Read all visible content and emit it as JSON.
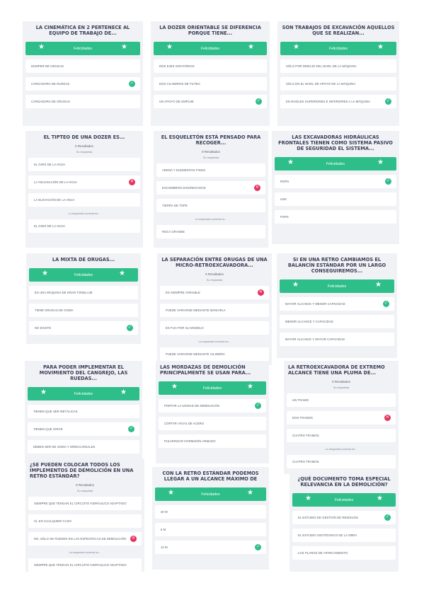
{
  "banner_label": "Felicidades",
  "cards": [
    {
      "q": "LA CINEMÁTICA EN 2 PERTENECE AL EQUIPO DE TRABAJO DE...",
      "banner": true,
      "options": [
        {
          "t": "DUMPER DE ORUGAS",
          "m": ""
        },
        {
          "t": "CARGADORA DE RUEDAS",
          "m": "ok"
        },
        {
          "t": "CARGADORA DE ORUGAS",
          "m": ""
        }
      ]
    },
    {
      "q": "LA DOZER ORIENTABLE SE DIFERENCIA PORQUE TIENE...",
      "banner": true,
      "options": [
        {
          "t": "DOS EJES GIRATORIOS",
          "m": ""
        },
        {
          "t": "DOS CILINDROS DE TILTEO",
          "m": ""
        },
        {
          "t": "UN APOYO DE EMPUJE",
          "m": "ok"
        }
      ]
    },
    {
      "q": "SON TRABAJOS DE EXCAVACIÓN AQUELLOS QUE SE REALIZAN...",
      "banner": true,
      "options": [
        {
          "t": "SÓLO POR DEBAJO DEL NIVEL DE LA MÁQUINA",
          "m": ""
        },
        {
          "t": "SÓLO EN EL NIVEL DE APOYO DE LA MÁQUINA",
          "m": ""
        },
        {
          "t": "EN NIVELES SUPERIORES E INFERIORES A LA MÁQUINA",
          "m": "ok"
        }
      ]
    },
    {
      "q": "EL TIPTEO DE UNA DOZER ES...",
      "res": "0 Resultados",
      "sub": "Su respuesta",
      "options": [
        {
          "t": "EL GIRO DE LA HOJA",
          "m": ""
        },
        {
          "t": "LA INCLINACIÓN DE LA HOJA",
          "m": "bad"
        },
        {
          "t": "LA ELEVACIÓN DE LA HOJA",
          "m": ""
        }
      ],
      "note": "La respuesta correcta es...",
      "extra": [
        {
          "t": "EL GIRO DE LA HOJA",
          "m": ""
        }
      ]
    },
    {
      "q": "EL ESQUELETÓN ESTÁ PENSADO PARA RECOGER...",
      "res": "0 Resultados",
      "sub": "Su respuesta",
      "options": [
        {
          "t": "ARENA Y ELEMENTOS FINOS",
          "m": ""
        },
        {
          "t": "ESCOMBROS DISGREGADOS",
          "m": "bad"
        },
        {
          "t": "TIERRA DE TOPE",
          "m": ""
        }
      ],
      "note": "La respuesta correcta es...",
      "extra": [
        {
          "t": "ROCA GRANDE",
          "m": ""
        }
      ]
    },
    {
      "q": "LAS EXCAVADORAS HIDRÁULICAS FRONTALES TIENEN COMO SISTEMA PASIVO DE SEGURIDAD EL SISTEMA...",
      "banner": true,
      "options": [
        {
          "t": "ROPS",
          "m": "ok"
        },
        {
          "t": "LMS",
          "m": ""
        },
        {
          "t": "FOPS",
          "m": ""
        }
      ]
    },
    {
      "q": "LA MIXTA DE ORUGAS...",
      "banner": true,
      "options": [
        {
          "t": "ES UNA MÁQUINA DE GRAN TONELAJE",
          "m": ""
        },
        {
          "t": "TIENE ORUGAS DE GOMA",
          "m": ""
        },
        {
          "t": "NO EXISTE",
          "m": "ok"
        }
      ]
    },
    {
      "q": "LA SEPARACIÓN ENTRE ORUGAS DE UNA MICRO-RETROEXCAVADORA...",
      "res": "0 Resultados",
      "sub": "Su respuesta",
      "options": [
        {
          "t": "ES SIEMPRE VARIABLE",
          "m": "bad"
        },
        {
          "t": "PUEDE VARIARSE MEDIANTE MANIVELA",
          "m": ""
        },
        {
          "t": "ES FIJA POR SU MODELO",
          "m": ""
        }
      ],
      "note": "La respuesta correcta es...",
      "extra": [
        {
          "t": "PUEDE VARIARSE MEDIANTE CILINDRO",
          "m": ""
        }
      ]
    },
    {
      "q": "SI EN UNA RETRO CAMBIAMOS EL BALANCÍN ESTÁNDAR POR UN LARGO CONSEGUIREMOS...",
      "banner": true,
      "options": [
        {
          "t": "MAYOR ALCANCE Y MENOR CAPACIDAD",
          "m": "ok"
        },
        {
          "t": "MENOR ALCANCE Y CAPACIDAD",
          "m": ""
        },
        {
          "t": "MAYOR ALCANCE Y MAYOR CAPACIDAD",
          "m": ""
        }
      ]
    },
    {
      "q": "PARA PODER IMPLEMENTAR EL MOVIMIENTO DEL CANGREJO, LAS RUEDAS...",
      "banner": true,
      "options": [
        {
          "t": "TIENEN QUE SER METÁLICAS",
          "m": ""
        },
        {
          "t": "TIENEN QUE GIRAR",
          "m": "ok"
        },
        {
          "t": "DEBEN SER DE GOMA Y DIRECCIONALES",
          "m": ""
        }
      ]
    },
    {
      "q": "LAS MORDAZAS DE DEMOLICIÓN PRINCIPALMENTE SE USAN PARA...",
      "left": true,
      "banner": true,
      "options": [
        {
          "t": "PORTAR LA UNIDAD DE DEMOLICIÓN",
          "m": "ok"
        },
        {
          "t": "CORTAR VIGAS DE ACERO",
          "m": ""
        },
        {
          "t": "PULVERIZAR HORMIGÓN ARMADO",
          "m": ""
        }
      ]
    },
    {
      "q": "LA RETROEXCAVADORA DE EXTREMO ALCANCE TIENE UNA PLUMA DE...",
      "left": true,
      "res": "0 Resultados",
      "sub": "Su respuesta",
      "options": [
        {
          "t": "UN TRAMO",
          "m": ""
        },
        {
          "t": "DOS TRAMOS",
          "m": "bad"
        },
        {
          "t": "CUATRO TRAMOS",
          "m": ""
        }
      ],
      "note": "La respuesta correcta es...",
      "extra": [
        {
          "t": "CUATRO TRAMOS",
          "m": ""
        }
      ]
    },
    {
      "q": "¿SE PUEDEN COLOCAR TODOS LOS IMPLEMENTOS DE DEMOLICIÓN EN UNA RETRO ESTÁNDAR?",
      "left": true,
      "res": "0 Resultados",
      "sub": "Su respuesta",
      "options": [
        {
          "t": "SIEMPRE QUE TENGAN EL CIRCUITO HIDRÁULICO ADAPTADO",
          "m": ""
        },
        {
          "t": "SÍ, EN CUALQUIER CASO",
          "m": ""
        },
        {
          "t": "NO, SÓLO SE PUEDEN EN LAS ESPECÍFICAS DE DEMOLICIÓN",
          "m": "bad"
        }
      ],
      "note": "La respuesta correcta es...",
      "extra": [
        {
          "t": "SIEMPRE QUE TENGAN EL CIRCUITO HIDRÁULICO ADAPTADO",
          "m": ""
        }
      ]
    },
    {
      "q": "CON LA RETRO ESTÁNDAR PODEMOS LLEGAR A UN ALCANCE MÁXIMO DE",
      "banner": true,
      "options": [
        {
          "t": "40 M",
          "m": ""
        },
        {
          "t": "6 M",
          "m": ""
        },
        {
          "t": "12 M",
          "m": "ok"
        }
      ]
    },
    {
      "q": "¿QUÉ DOCUMENTO TOMA ESPECIAL RELEVANCIA EN LA DEMOLICIÓN?",
      "banner": true,
      "options": [
        {
          "t": "EL ESTUDIO DE GESTIÓN DE RESIDUOS",
          "m": "ok"
        },
        {
          "t": "EL ESTUDIO GEOTÉCNICO DE LA OBRA",
          "m": ""
        },
        {
          "t": "LOS PLANOS DE APARCAMIENTO",
          "m": ""
        }
      ]
    }
  ]
}
